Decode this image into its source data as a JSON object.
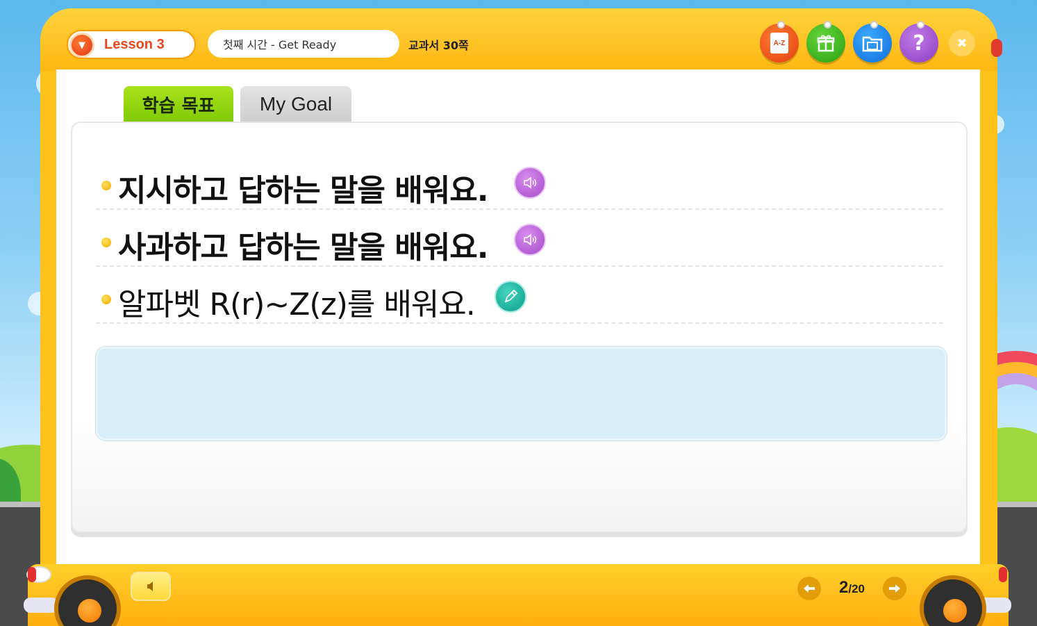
{
  "header": {
    "lesson_label": "Lesson 3",
    "title": "첫째 시간 - Get Ready",
    "page_ref": "교과서 30쪽",
    "buttons": {
      "az_label": "A-Z",
      "help_glyph": "?",
      "close_glyph": "✖"
    }
  },
  "tabs": [
    {
      "label": "학습 목표",
      "active": true
    },
    {
      "label": "My Goal",
      "active": false
    }
  ],
  "goals": [
    {
      "text": "지시하고 답하는 말을 배워요.",
      "action_icon": "speaker-icon"
    },
    {
      "text": "사과하고 답하는 말을 배워요.",
      "action_icon": "speaker-icon"
    },
    {
      "text": "알파벳 R(r)~Z(z)를 배워요.",
      "action_icon": "pencil-icon"
    }
  ],
  "pager": {
    "current": "2",
    "total": "/20"
  },
  "colors": {
    "bus_yellow": "#ffc21a",
    "tab_active": "#8fd20f",
    "audio_purple": "#b45ad6",
    "edit_teal": "#14b09a",
    "answer_box": "#d7edf7"
  }
}
